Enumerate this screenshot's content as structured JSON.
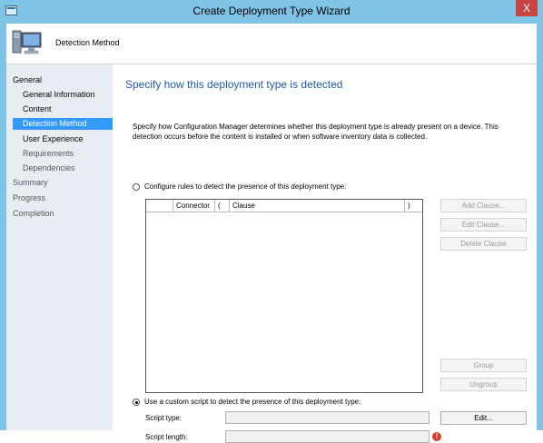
{
  "window": {
    "title": "Create Deployment Type Wizard",
    "close_label": "X"
  },
  "header": {
    "title": "Detection Method"
  },
  "nav": {
    "items": [
      {
        "label": "General"
      },
      {
        "label": "General Information"
      },
      {
        "label": "Content"
      },
      {
        "label": "Detection Method"
      },
      {
        "label": "User Experience"
      },
      {
        "label": "Requirements"
      },
      {
        "label": "Dependencies"
      },
      {
        "label": "Summary"
      },
      {
        "label": "Progress"
      },
      {
        "label": "Completion"
      }
    ]
  },
  "main": {
    "title": "Specify how this deployment type is detected",
    "description": "Specify how Configuration Manager determines whether this deployment type is already present on a device. This detection occurs before the content is installed or when software inventory data is collected.",
    "rules_option": {
      "label": "Configure rules to detect the presence of this deployment type:",
      "checked": false
    },
    "script_option": {
      "label": "Use a custom script to detect the presence of this deployment type:",
      "checked": true
    },
    "grid_columns": [
      "",
      "Connector",
      "(",
      "Clause",
      ")"
    ],
    "buttons": {
      "add_clause": "Add Clause...",
      "edit_clause": "Edit Clause...",
      "delete_clause": "Delete Clause",
      "group": "Group",
      "ungroup": "Ungroup",
      "edit": "Edit..."
    },
    "script_type_label": "Script type:",
    "script_type_value": "",
    "script_length_label": "Script length:",
    "script_length_value": "",
    "error_icon": "!"
  },
  "colors": {
    "frame": "#7fc4e6",
    "nav_background": "#e8edf3",
    "nav_selected": "#3399ff",
    "title_blue": "#1e5aa8",
    "close": "#c74343"
  }
}
